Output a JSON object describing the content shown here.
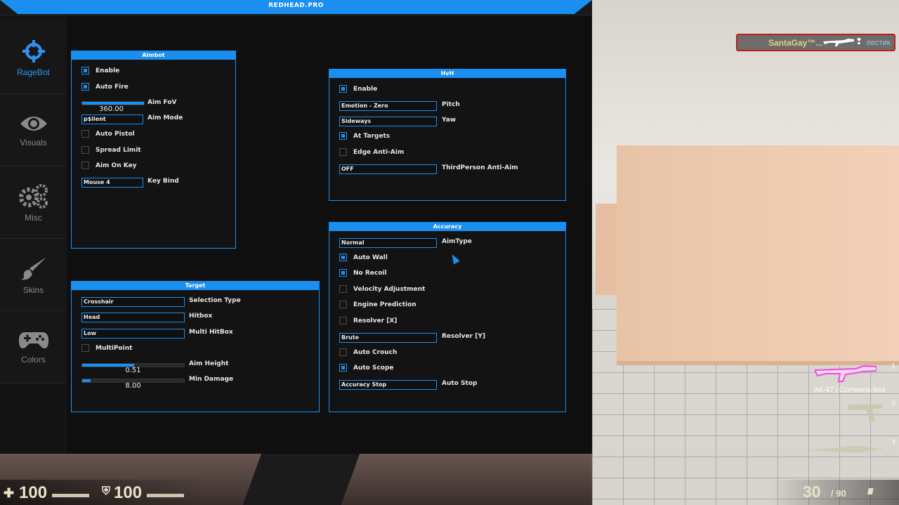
{
  "window": {
    "title": "REDHEAD.PRO"
  },
  "sidebar": {
    "items": [
      {
        "label": "RageBot",
        "icon": "crosshair-icon",
        "active": true
      },
      {
        "label": "Visuals",
        "icon": "eye-icon",
        "active": false
      },
      {
        "label": "Misc",
        "icon": "gears-icon",
        "active": false
      },
      {
        "label": "Skins",
        "icon": "brush-icon",
        "active": false
      },
      {
        "label": "Colors",
        "icon": "gamepad-icon",
        "active": false
      }
    ]
  },
  "aimbot": {
    "title": "Aimbot",
    "enable": {
      "label": "Enable",
      "checked": true
    },
    "auto_fire": {
      "label": "Auto Fire",
      "checked": true
    },
    "aim_fov": {
      "label": "Aim FoV",
      "value": "360.00",
      "fraction": 1.0
    },
    "aim_mode": {
      "label": "Aim Mode",
      "value": "p$ilent"
    },
    "auto_pistol": {
      "label": "Auto Pistol",
      "checked": false
    },
    "spread_limit": {
      "label": "Spread Limit",
      "checked": false
    },
    "aim_on_key": {
      "label": "Aim On Key",
      "checked": false
    },
    "key_bind": {
      "label": "Key Bind",
      "value": "Mouse 4"
    }
  },
  "target": {
    "title": "Target",
    "selection_type": {
      "label": "Selection Type",
      "value": "Crosshair"
    },
    "hitbox": {
      "label": "Hitbox",
      "value": "Head"
    },
    "multi_hitbox": {
      "label": "Multi HitBox",
      "value": "Low"
    },
    "multipoint": {
      "label": "MultiPoint",
      "checked": false
    },
    "aim_height": {
      "label": "Aim Height",
      "value": "0.51",
      "fraction": 0.51
    },
    "min_damage": {
      "label": "Min Damage",
      "value": "8.00",
      "fraction": 0.08
    }
  },
  "hvh": {
    "title": "HvH",
    "enable": {
      "label": "Enable",
      "checked": true
    },
    "pitch": {
      "label": "Pitch",
      "value": "Emotion - Zero"
    },
    "yaw": {
      "label": "Yaw",
      "value": "Sideways"
    },
    "at_targets": {
      "label": "At Targets",
      "checked": true
    },
    "edge_anti_aim": {
      "label": "Edge Anti-Aim",
      "checked": false
    },
    "thirdperson": {
      "label": "ThirdPerson Anti-Aim",
      "value": "OFF"
    }
  },
  "accuracy": {
    "title": "Accuracy",
    "aimtype": {
      "label": "AimType",
      "value": "Normal"
    },
    "auto_wall": {
      "label": "Auto Wall",
      "checked": true
    },
    "no_recoil": {
      "label": "No Recoil",
      "checked": true
    },
    "velocity_adjustment": {
      "label": "Velocity Adjustment",
      "checked": false
    },
    "engine_prediction": {
      "label": "Engine Prediction",
      "checked": false
    },
    "resolver_x": {
      "label": "Resolver [X]",
      "checked": false
    },
    "resolver_y": {
      "label": "Resolver [Y]",
      "value": "Brute"
    },
    "auto_crouch": {
      "label": "Auto Crouch",
      "checked": false
    },
    "auto_scope": {
      "label": "Auto Scope",
      "checked": true
    },
    "auto_stop": {
      "label": "Auto Stop",
      "value": "Accuracy Stop"
    }
  },
  "hud": {
    "health": "100",
    "armor": "100",
    "ammo": "30",
    "reserve": "/ 90",
    "killfeed": {
      "killer": "SantaGay™...",
      "victim": "пестик"
    },
    "weapons": [
      {
        "slot": "1",
        "name": "AK-47 | Czerwona linia"
      },
      {
        "slot": "2",
        "name": ""
      },
      {
        "slot": "3",
        "name": ""
      }
    ]
  },
  "colors": {
    "accent": "#1a8ff0",
    "panel_bg": "#131314",
    "sidebar_bg": "#141414"
  }
}
